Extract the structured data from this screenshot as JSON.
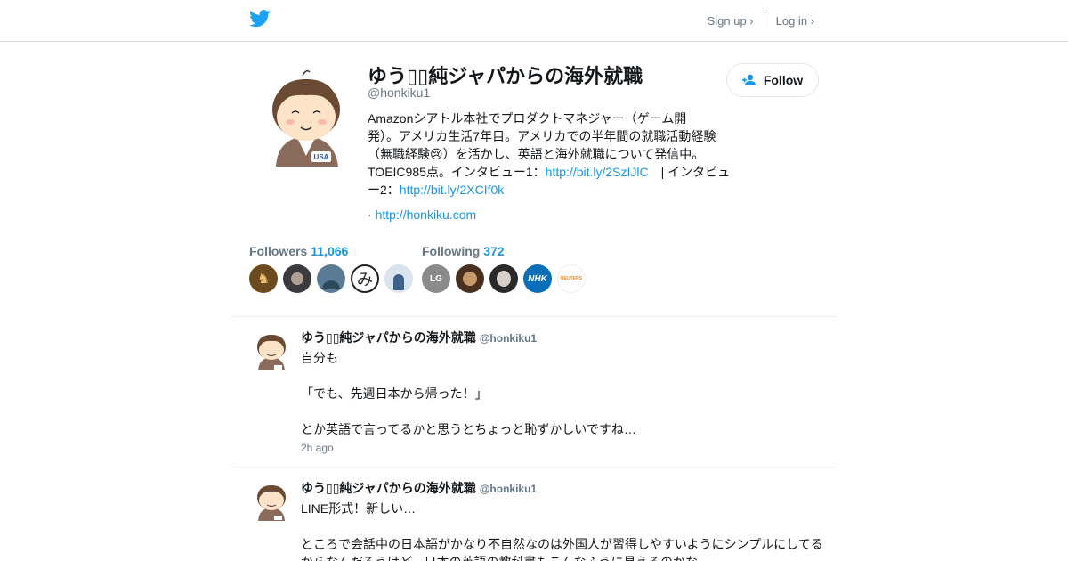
{
  "header": {
    "logo_icon": "twitter-bird-icon",
    "signup_label": "Sign up ›",
    "login_label": "Log in ›"
  },
  "profile": {
    "name": "ゆう▯▯純ジャパからの海外就職",
    "handle": "@honkiku1",
    "follow_label": "Follow",
    "bio_line1": "Amazonシアトル本社でプロダクトマネジャー（ゲーム開",
    "bio_line2": "発）。アメリカ生活7年目。アメリカでの半年間の就職活動経験",
    "bio_line3_a": "（無職経験",
    "bio_emoji": "😢",
    "bio_line3_b": "）を活かし、英語と海外就職について発信中。",
    "bio_line4_a": "TOEIC985点。インタビュー1：",
    "bio_link1": "http://bit.ly/2SzIJlC",
    "bio_line4_b": "　| インタビュ",
    "bio_line5_a": "ー2：",
    "bio_link2": "http://bit.ly/2XCIf0k",
    "website_prefix": "· ",
    "website": "http://honkiku.com"
  },
  "stats": {
    "followers_label": "Followers",
    "followers_count": "11,066",
    "following_label": "Following",
    "following_count": "372",
    "following_avatar_texts": [
      "LG",
      "",
      "",
      "NHK",
      "REUTERS"
    ],
    "follower_avatar_texts": [
      "",
      "",
      "",
      "み",
      ""
    ]
  },
  "tweets": [
    {
      "name": "ゆう▯▯純ジャパからの海外就職",
      "handle": "@honkiku1",
      "lines": [
        "自分も",
        "",
        "「でも、先週日本から帰った！」",
        "",
        "とか英語で言ってるかと思うとちょっと恥ずかしいですね…"
      ],
      "time": "2h ago"
    },
    {
      "name": "ゆう▯▯純ジャパからの海外就職",
      "handle": "@honkiku1",
      "lines": [
        "LINE形式！新しい…",
        "",
        "ところで会話中の日本語がかなり不自然なのは外国人が習得しやすいようにシンプルにしてる",
        "からなんだろうけど、日本の英語の教科書もこんなふうに見えるのかな"
      ],
      "time": ""
    }
  ],
  "colors": {
    "link": "#1b95e0",
    "muted": "#657786",
    "text": "#14171a",
    "twitter_blue": "#1da1f2"
  }
}
